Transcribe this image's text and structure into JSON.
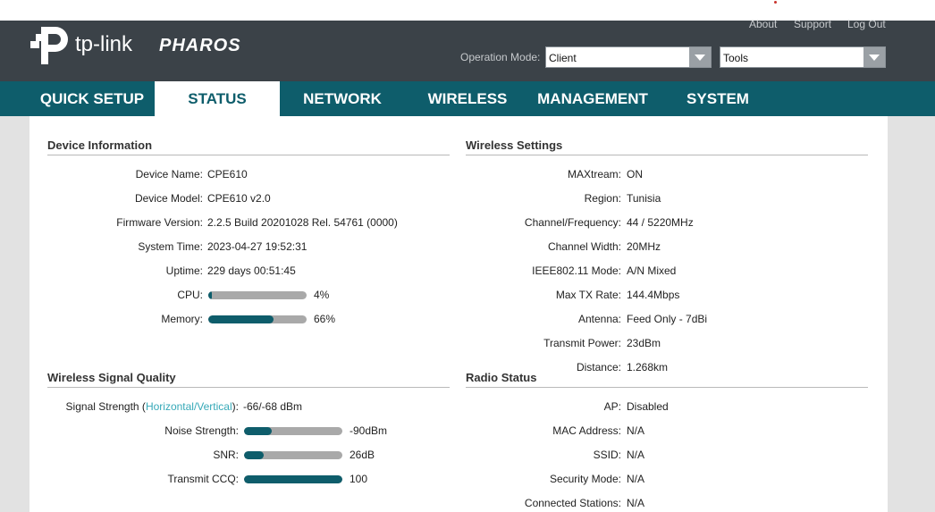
{
  "header": {
    "brand": "tp-link",
    "product": "PHAROS",
    "links": {
      "about": "About",
      "support": "Support",
      "logout": "Log Out"
    },
    "operation_mode_label": "Operation Mode:",
    "operation_mode_value": "Client",
    "tools_value": "Tools"
  },
  "nav": {
    "tabs": [
      {
        "label": "QUICK SETUP"
      },
      {
        "label": "STATUS"
      },
      {
        "label": "NETWORK"
      },
      {
        "label": "WIRELESS"
      },
      {
        "label": "MANAGEMENT"
      },
      {
        "label": "SYSTEM"
      }
    ],
    "active": "STATUS"
  },
  "device_info": {
    "title": "Device Information",
    "rows": [
      {
        "label": "Device Name:",
        "value": "CPE610"
      },
      {
        "label": "Device Model:",
        "value": "CPE610 v2.0"
      },
      {
        "label": "Firmware Version:",
        "value": "2.2.5 Build 20201028 Rel. 54761 (0000)"
      },
      {
        "label": "System Time:",
        "value": "2023-04-27 19:52:31"
      },
      {
        "label": "Uptime:",
        "value": "229 days 00:51:45"
      }
    ],
    "cpu": {
      "label": "CPU:",
      "value": "4%",
      "fraction": 0.04
    },
    "memory": {
      "label": "Memory:",
      "value": "66%",
      "fraction": 0.66
    }
  },
  "wireless_settings": {
    "title": "Wireless Settings",
    "rows": [
      {
        "label": "MAXtream:",
        "value": "ON"
      },
      {
        "label": "Region:",
        "value": "Tunisia"
      },
      {
        "label": "Channel/Frequency:",
        "value": "44 / 5220MHz"
      },
      {
        "label": "Channel Width:",
        "value": "20MHz"
      },
      {
        "label": "IEEE802.11 Mode:",
        "value": "A/N Mixed"
      },
      {
        "label": "Max TX Rate:",
        "value": "144.4Mbps"
      },
      {
        "label": "Antenna:",
        "value": "Feed Only - 7dBi"
      },
      {
        "label": "Transmit Power:",
        "value": "23dBm"
      },
      {
        "label": "Distance:",
        "value": "1.268km"
      }
    ]
  },
  "signal_quality": {
    "title": "Wireless Signal Quality",
    "signal_strength": {
      "label_prefix": "Signal Strength (",
      "label_link": "Horizontal/Vertical",
      "label_suffix": "):",
      "value": "-66/-68 dBm"
    },
    "noise": {
      "label": "Noise Strength:",
      "value": "-90dBm",
      "fraction": 0.28
    },
    "snr": {
      "label": "SNR:",
      "value": "26dB",
      "fraction": 0.2
    },
    "ccq": {
      "label": "Transmit CCQ:",
      "value": "100",
      "fraction": 1.0
    }
  },
  "radio_status": {
    "title": "Radio Status",
    "rows": [
      {
        "label": "AP:",
        "value": "Disabled"
      },
      {
        "label": "MAC Address:",
        "value": "N/A"
      },
      {
        "label": "SSID:",
        "value": "N/A"
      },
      {
        "label": "Security Mode:",
        "value": "N/A"
      },
      {
        "label": "Connected Stations:",
        "value": "N/A"
      }
    ]
  },
  "colors": {
    "header_bg": "#3b4248",
    "nav_bg": "#0e5d6b",
    "accent_link": "#36a9b8",
    "bar_track": "#a9a9a9"
  }
}
